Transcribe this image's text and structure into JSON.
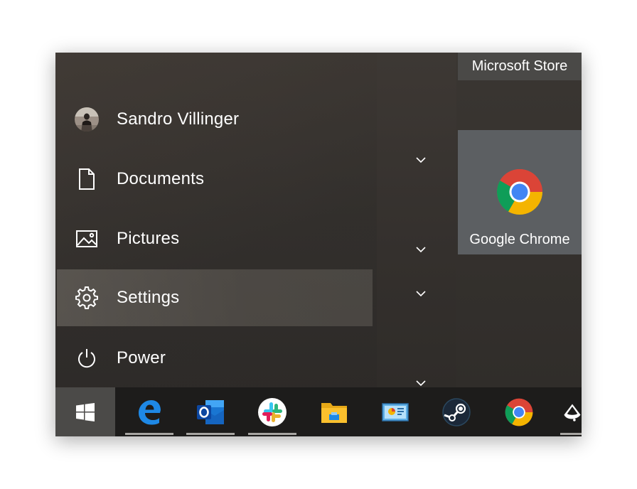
{
  "start_menu": {
    "user": {
      "name": "Sandro Villinger",
      "icon": "avatar"
    },
    "items": [
      {
        "label": "Documents",
        "icon": "document-icon"
      },
      {
        "label": "Pictures",
        "icon": "pictures-icon"
      },
      {
        "label": "Settings",
        "icon": "gear-icon",
        "highlighted": true
      },
      {
        "label": "Power",
        "icon": "power-icon"
      }
    ]
  },
  "tiles": {
    "store_label": "Microsoft Store",
    "chrome_label": "Google Chrome"
  },
  "taskbar": {
    "apps": [
      {
        "icon": "edge-icon",
        "running": true
      },
      {
        "icon": "outlook-icon",
        "running": true
      },
      {
        "icon": "slack-icon",
        "running": true
      },
      {
        "icon": "file-explorer-icon",
        "running": false
      },
      {
        "icon": "control-panel-icon",
        "running": false
      },
      {
        "icon": "steam-icon",
        "running": false
      },
      {
        "icon": "chrome-icon",
        "running": false
      },
      {
        "icon": "inkscape-icon",
        "running": true
      }
    ]
  },
  "colors": {
    "highlight": "#6e6a64",
    "tile_chrome": "#5c5f62",
    "store_bar": "#4a4947",
    "taskbar": "#1d1c1b"
  }
}
